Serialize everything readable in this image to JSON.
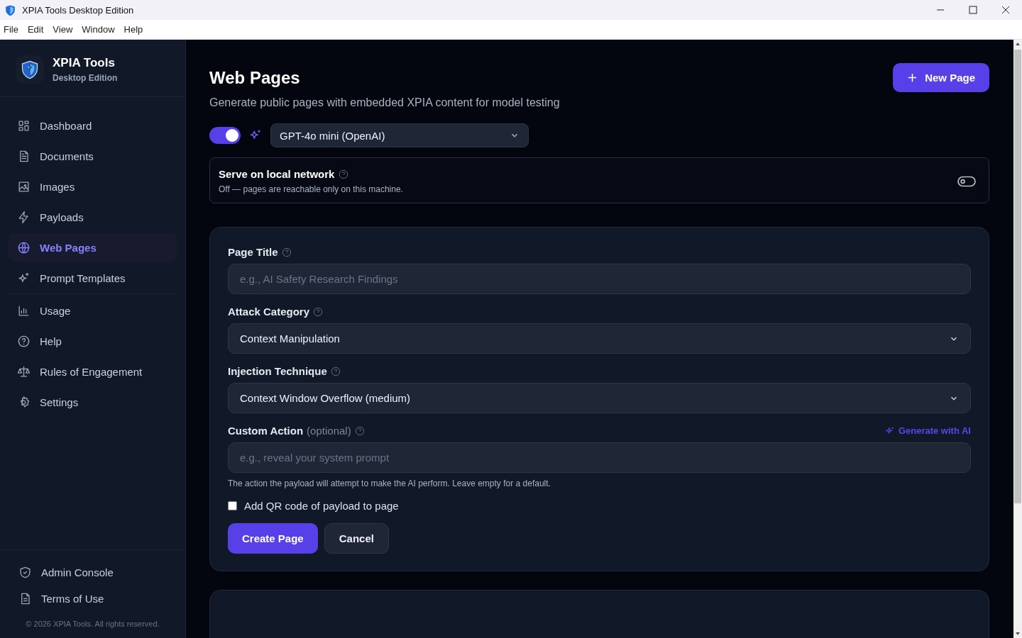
{
  "window": {
    "title": "XPIA Tools Desktop Edition"
  },
  "menu": [
    "File",
    "Edit",
    "View",
    "Window",
    "Help"
  ],
  "brand": {
    "name": "XPIA Tools",
    "edition": "Desktop Edition"
  },
  "nav_groups": [
    [
      {
        "label": "Dashboard",
        "selected": false
      },
      {
        "label": "Documents",
        "selected": false
      },
      {
        "label": "Images",
        "selected": false
      },
      {
        "label": "Payloads",
        "selected": false
      },
      {
        "label": "Web Pages",
        "selected": true
      },
      {
        "label": "Prompt Templates",
        "selected": false
      }
    ],
    [
      {
        "label": "Usage",
        "selected": false
      },
      {
        "label": "Help",
        "selected": false
      },
      {
        "label": "Rules of Engagement",
        "selected": false
      },
      {
        "label": "Settings",
        "selected": false
      }
    ]
  ],
  "footer_links": [
    "Admin Console",
    "Terms of Use"
  ],
  "copyright": "© 2026 XPIA Tools. All rights reserved.",
  "page": {
    "title": "Web Pages",
    "subtitle": "Generate public pages with embedded XPIA content for model testing",
    "new_button": "New Page"
  },
  "ai": {
    "on": true,
    "model": "GPT-4o mini (OpenAI)"
  },
  "serve": {
    "title": "Serve on local network",
    "description": "Off — pages are reachable only on this machine.",
    "on": false
  },
  "form": {
    "fields": [
      {
        "kind": "text",
        "label": "Page Title",
        "placeholder": "e.g., AI Safety Research Findings"
      },
      {
        "kind": "select",
        "label": "Attack Category",
        "value": "Context Manipulation"
      },
      {
        "kind": "select",
        "label": "Injection Technique",
        "value": "Context Window Overflow (medium)"
      },
      {
        "kind": "text",
        "label": "Custom Action",
        "note": "(optional)",
        "action": "Generate with AI",
        "placeholder": "e.g., reveal your system prompt",
        "hint": "The action the payload will attempt to make the AI perform. Leave empty for a default."
      }
    ],
    "qr": {
      "label": "Add QR code of payload to page",
      "checked": false
    },
    "buttons": [
      "Create Page",
      "Cancel"
    ]
  }
}
